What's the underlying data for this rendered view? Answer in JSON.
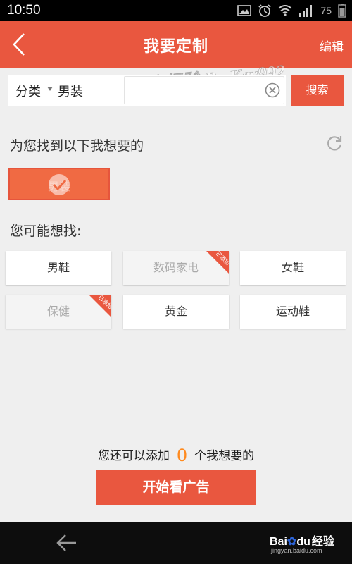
{
  "status_bar": {
    "time": "10:50",
    "battery": "75"
  },
  "header": {
    "title": "我要定制",
    "edit_label": "编辑"
  },
  "search": {
    "category_label": "分类",
    "category_value": "男装",
    "button_label": "搜索"
  },
  "section_found": {
    "title": "为您找到以下我想要的",
    "selected_tags": [
      {
        "label": "男装"
      }
    ]
  },
  "section_suggest": {
    "title": "您可能想找:",
    "tags": [
      {
        "label": "男鞋",
        "added": false
      },
      {
        "label": "数码家电",
        "added": true
      },
      {
        "label": "女鞋",
        "added": false
      },
      {
        "label": "保健",
        "added": true
      },
      {
        "label": "黄金",
        "added": false
      },
      {
        "label": "运动鞋",
        "added": false
      }
    ],
    "added_badge": "已添加"
  },
  "footer": {
    "count_prefix": "您还可以添加",
    "count": "0",
    "count_suffix": "个我想要的",
    "start_button": "开始看广告"
  },
  "watermark": "百度经验 By Key992",
  "branding": {
    "logo_text_a": "Bai",
    "logo_text_b": "du",
    "logo_text_c": "经验",
    "url": "jingyan.baidu.com"
  },
  "colors": {
    "accent": "#e9573f",
    "count_color": "#ff8a1e"
  }
}
